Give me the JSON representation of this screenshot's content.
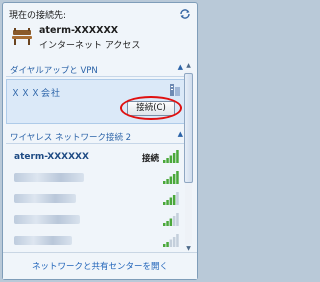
{
  "current": {
    "label": "現在の接続先:",
    "network_name": "aterm-XXXXXX",
    "access": "インターネット アクセス",
    "refresh_icon": "refresh-icon",
    "network_icon": "bench-network-icon"
  },
  "vpn_section": {
    "title": "ダイヤルアップと VPN",
    "item_name": "ＸＸＸ会社",
    "connect_label": "接続(C)"
  },
  "wifi_section": {
    "title": "ワイヤレス ネットワーク接続 2",
    "networks": [
      {
        "name": "aterm-XXXXXX",
        "status": "接続"
      }
    ]
  },
  "footer": {
    "link": "ネットワークと共有センターを開く"
  },
  "colors": {
    "accent": "#2b63a8",
    "highlight_border": "#e01010",
    "signal": "#4aa83a"
  }
}
